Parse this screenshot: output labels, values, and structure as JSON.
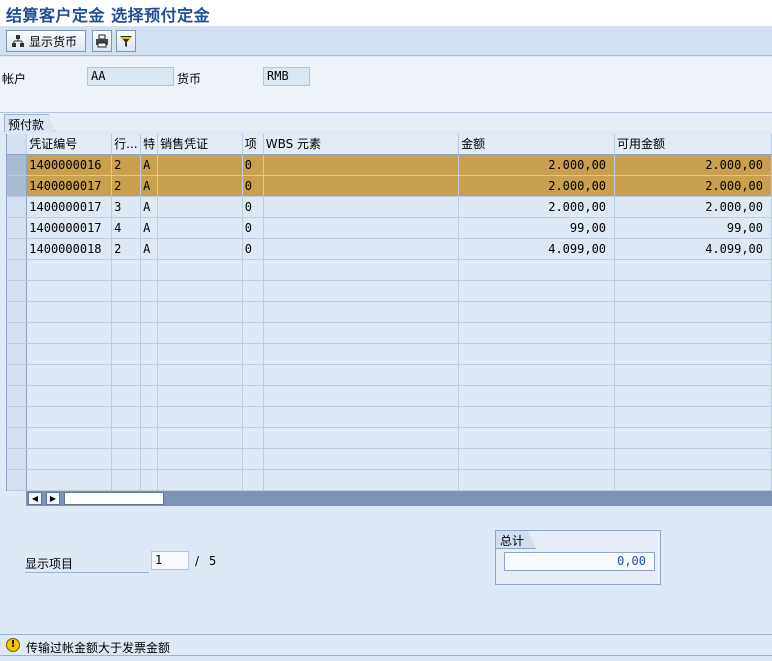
{
  "window": {
    "title": "结算客户定金 选择预付定金"
  },
  "toolbar": {
    "currency_button_label": "显示货币",
    "print_icon": "printer-icon",
    "filter_icon": "filter-icon"
  },
  "header": {
    "account_label": "帐户",
    "account_value": "AA",
    "currency_label": "货币",
    "currency_value": "RMB"
  },
  "tab": {
    "label": "预付款"
  },
  "table": {
    "columns": [
      "凭证编号",
      "行...",
      "特",
      "销售凭证",
      "项",
      "WBS 元素",
      "金额",
      "可用金额"
    ],
    "rows": [
      {
        "doc": "1400000016",
        "line": "2",
        "sp": "A",
        "sales": "",
        "item": "0",
        "wbs": "",
        "amount": "2.000,00",
        "available": "2.000,00",
        "selected": true
      },
      {
        "doc": "1400000017",
        "line": "2",
        "sp": "A",
        "sales": "",
        "item": "0",
        "wbs": "",
        "amount": "2.000,00",
        "available": "2.000,00",
        "selected": true
      },
      {
        "doc": "1400000017",
        "line": "3",
        "sp": "A",
        "sales": "",
        "item": "0",
        "wbs": "",
        "amount": "2.000,00",
        "available": "2.000,00",
        "selected": false
      },
      {
        "doc": "1400000017",
        "line": "4",
        "sp": "A",
        "sales": "",
        "item": "0",
        "wbs": "",
        "amount": "99,00",
        "available": "99,00",
        "selected": false
      },
      {
        "doc": "1400000018",
        "line": "2",
        "sp": "A",
        "sales": "",
        "item": "0",
        "wbs": "",
        "amount": "4.099,00",
        "available": "4.099,00",
        "selected": false
      }
    ],
    "empty_rows": 11,
    "highlight_color": "#c8a04e"
  },
  "paging": {
    "label": "显示项目",
    "current": "1",
    "separator": "/",
    "total": "5"
  },
  "total": {
    "label": "总计",
    "value": "0,00"
  },
  "status": {
    "icon": "warning-icon",
    "message": "传输过帐金额大于发票金额"
  }
}
